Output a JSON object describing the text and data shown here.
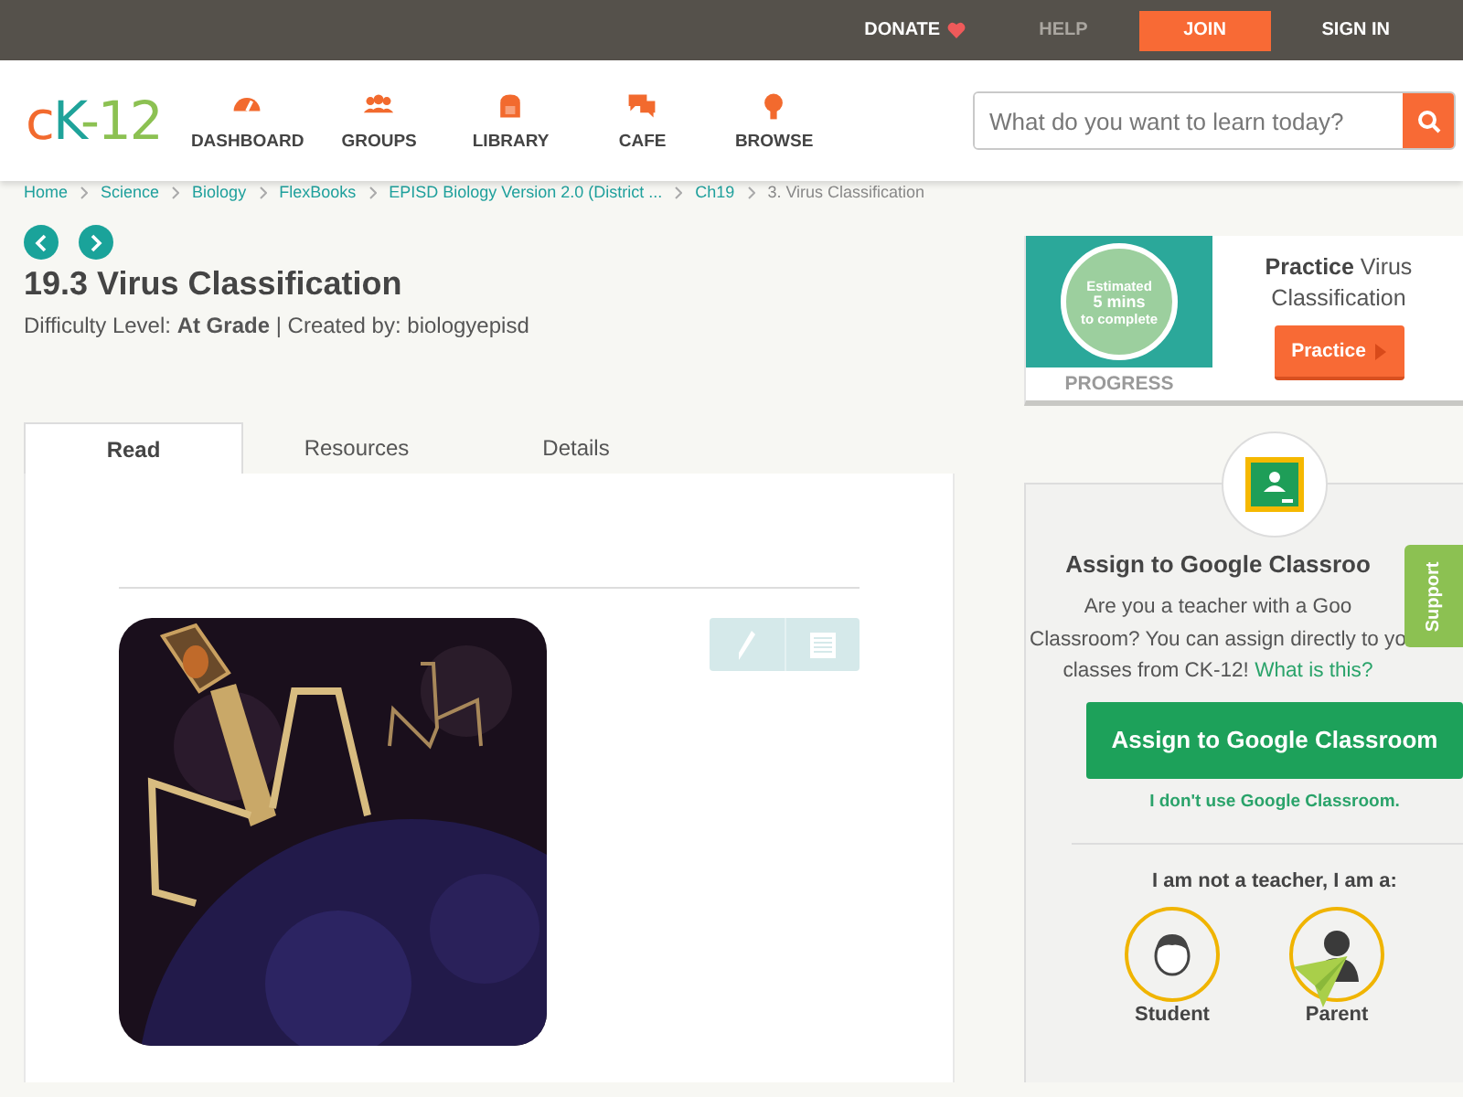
{
  "top_bar": {
    "links": [
      {
        "label": "DONATE",
        "kind": "donate"
      },
      {
        "label": "HELP",
        "kind": "help"
      },
      {
        "label": "JOIN",
        "kind": "join"
      },
      {
        "label": "SIGN IN",
        "kind": "signin"
      }
    ]
  },
  "nav": {
    "logo": [
      {
        "text": "c",
        "color": "#f26a2e"
      },
      {
        "text": "K",
        "color": "#1fa39a"
      },
      {
        "text": "-12",
        "color": "#8cc152"
      }
    ],
    "items": [
      {
        "label": "DASHBOARD"
      },
      {
        "label": "GROUPS"
      },
      {
        "label": "LIBRARY"
      },
      {
        "label": "CAFE"
      },
      {
        "label": "BROWSE"
      }
    ],
    "search": {
      "placeholder": "What do you want to learn today?"
    }
  },
  "breadcrumb": [
    {
      "label": "Home",
      "current": false
    },
    {
      "label": "Science",
      "current": false
    },
    {
      "label": "Biology",
      "current": false
    },
    {
      "label": "FlexBooks",
      "current": false
    },
    {
      "label": "EPISD Biology Version 2.0 (District ...",
      "current": false
    },
    {
      "label": "Ch19",
      "current": false
    },
    {
      "label": "3. Virus Classification",
      "current": true
    }
  ],
  "title": "19.3 Virus Classification",
  "meta": "Difficulty Level: **At Grade** | Created by: biologyepisd",
  "tabs": [
    {
      "label": "Read",
      "selected": true
    },
    {
      "label": "Resources",
      "selected": false
    },
    {
      "label": "Details",
      "selected": false
    }
  ],
  "practice": {
    "estimate": [
      "Estimated",
      "5 mins",
      "to complete"
    ],
    "progress_label": "PROGRESS",
    "title": "**Practice** Virus Classification",
    "button": "Practice"
  },
  "classroom": {
    "title": "Assign to Google Classroo",
    "text": "Are you a teacher with a Goo\nClassroom? You can assign directly to yo\nclasses from CK-12!",
    "link": "What is this?",
    "button": "Assign to Google Classroom",
    "decline": "I don't use Google Classroom.",
    "role_prompt": "I am not a teacher, I am a:",
    "roles": [
      {
        "label": "Student",
        "kind": "student"
      },
      {
        "label": "Parent",
        "kind": "parent"
      }
    ]
  },
  "support": "Support"
}
